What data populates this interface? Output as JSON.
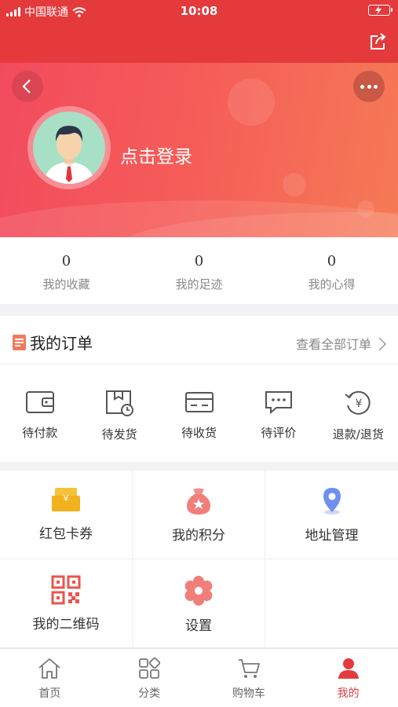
{
  "status_bar": {
    "carrier": "中国联通",
    "time": "10:08"
  },
  "profile": {
    "login_text": "点击登录"
  },
  "stats": [
    {
      "value": "0",
      "label": "我的收藏"
    },
    {
      "value": "0",
      "label": "我的足迹"
    },
    {
      "value": "0",
      "label": "我的心得"
    }
  ],
  "orders": {
    "title": "我的订单",
    "view_all": "查看全部订单",
    "items": [
      {
        "label": "待付款",
        "icon": "wallet-icon"
      },
      {
        "label": "待发货",
        "icon": "package-clock-icon"
      },
      {
        "label": "待收货",
        "icon": "truck-box-icon"
      },
      {
        "label": "待评价",
        "icon": "comment-icon"
      },
      {
        "label": "退款/退货",
        "icon": "refund-icon"
      }
    ]
  },
  "services": [
    {
      "label": "红包卡券",
      "icon": "coupon-icon"
    },
    {
      "label": "我的积分",
      "icon": "points-bag-icon"
    },
    {
      "label": "地址管理",
      "icon": "location-pin-icon"
    },
    {
      "label": "我的二维码",
      "icon": "qr-code-icon"
    },
    {
      "label": "设置",
      "icon": "settings-gear-icon"
    }
  ],
  "tabbar": [
    {
      "label": "首页",
      "icon": "home-icon"
    },
    {
      "label": "分类",
      "icon": "category-icon"
    },
    {
      "label": "购物车",
      "icon": "cart-icon"
    },
    {
      "label": "我的",
      "icon": "user-icon",
      "active": true
    }
  ],
  "colors": {
    "brand_red": "#e43a3c",
    "hero_start": "#f24b5e",
    "hero_end": "#f57a55"
  }
}
